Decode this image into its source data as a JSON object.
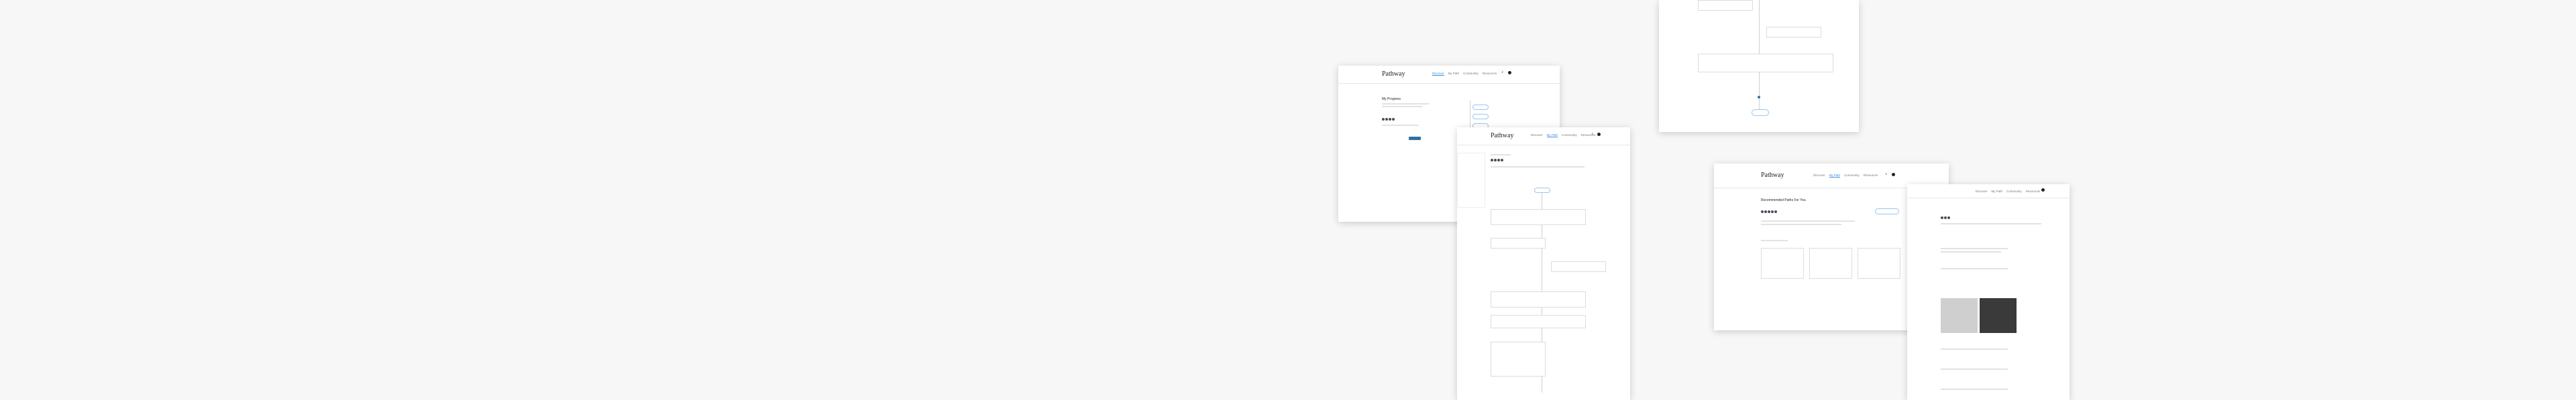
{
  "logo": "Pathway",
  "nav": {
    "items": [
      "Discover",
      "My Path",
      "Community",
      "Resources"
    ]
  },
  "sections": {
    "my_progress": "My Progress",
    "recommended": "Recommended Paths For You"
  },
  "colors": {
    "accent": "#3a8dde",
    "button": "#2f6fa6",
    "background": "#f7f7f7"
  }
}
